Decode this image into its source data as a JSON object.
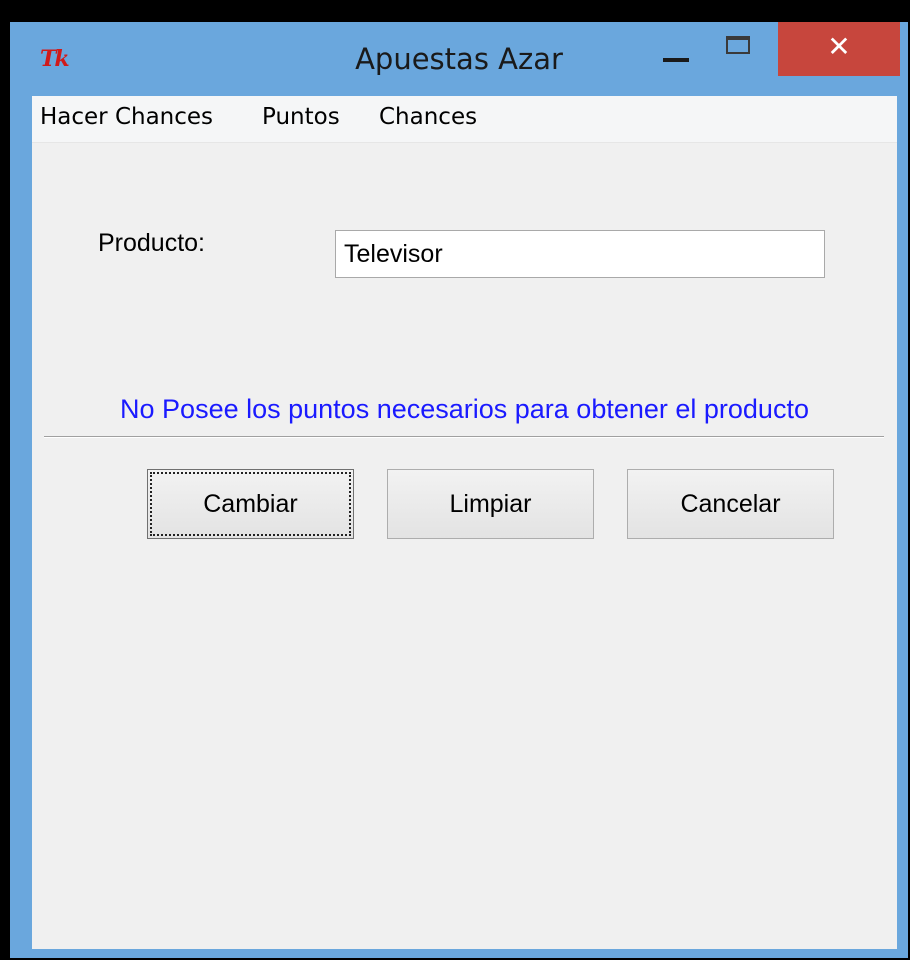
{
  "window": {
    "title": "Apuestas Azar",
    "icon": "tk-feather-icon",
    "close_glyph": "✕"
  },
  "menu": {
    "items": [
      "Hacer Chances",
      "Puntos",
      "Chances"
    ]
  },
  "form": {
    "producto_label": "Producto:",
    "producto_value": "Televisor"
  },
  "status": {
    "message": "No Posee los puntos necesarios para obtener el producto",
    "color": "#1a1aff"
  },
  "buttons": {
    "cambiar": "Cambiar",
    "limpiar": "Limpiar",
    "cancelar": "Cancelar"
  },
  "colors": {
    "titlebar": "#6aa7dd",
    "close": "#c7463d",
    "client": "#f0f0f0"
  }
}
